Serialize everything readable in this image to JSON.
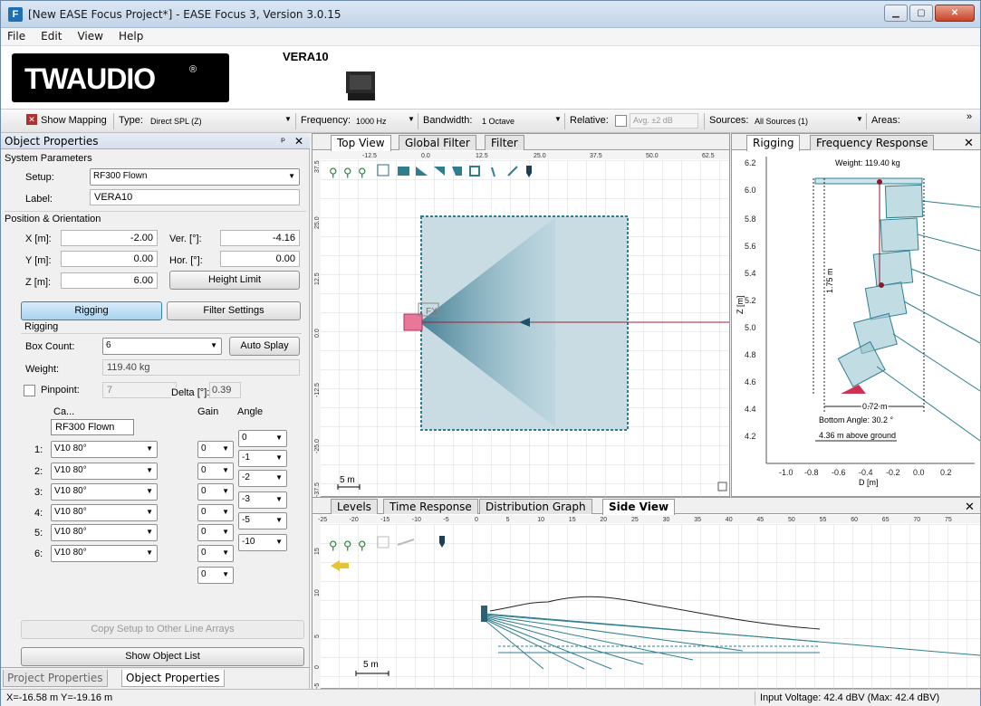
{
  "window": {
    "title": "[New EASE Focus Project*] - EASE Focus 3, Version 3.0.15"
  },
  "menu": [
    "File",
    "Edit",
    "View",
    "Help"
  ],
  "brand": {
    "logo_text": "TWAUDIO",
    "logo_mark": "®",
    "device_name": "VERA10"
  },
  "toolbar": {
    "show_mapping": "Show Mapping",
    "type_label": "Type:",
    "type_value": "Direct SPL (Z)",
    "frequency_label": "Frequency:",
    "frequency_value": "1000 Hz",
    "bandwidth_label": "Bandwidth:",
    "bandwidth_value": "1 Octave",
    "relative_label": "Relative:",
    "avg_value": "Avg. ±2 dB",
    "sources_label": "Sources:",
    "sources_value": "All Sources (1)",
    "areas_label": "Areas:",
    "overflow": "»"
  },
  "object_properties": {
    "header": "Object Properties",
    "pin": "ᵖ",
    "close": "✕",
    "system_parameters": "System Parameters",
    "setup_label": "Setup:",
    "setup_value": "RF300 Flown",
    "label_label": "Label:",
    "label_value": "VERA10",
    "position_orientation": "Position & Orientation",
    "x_label": "X [m]:",
    "x_value": "-2.00",
    "y_label": "Y [m]:",
    "y_value": "0.00",
    "z_label": "Z [m]:",
    "z_value": "6.00",
    "ver_label": "Ver. [°]:",
    "ver_value": "-4.16",
    "hor_label": "Hor. [°]:",
    "hor_value": "0.00",
    "height_limit": "Height Limit",
    "rigging_button": "Rigging",
    "filter_settings_button": "Filter Settings",
    "rigging_title": "Rigging",
    "box_count_label": "Box Count:",
    "box_count_value": "6",
    "auto_splay": "Auto Splay",
    "weight_label": "Weight:",
    "weight_value": "119.40 kg",
    "pinpoint_label": "Pinpoint:",
    "pinpoint_value": "7",
    "delta_label": "Delta [°]:",
    "delta_value": "0.39",
    "col_cabinet": "Ca...",
    "col_gain": "Gain",
    "col_angle": "Angle",
    "cabinet_header_value": "RF300 Flown",
    "boxes": [
      {
        "num": "1:",
        "cabinet": "V10 80°",
        "gain": "0"
      },
      {
        "num": "2:",
        "cabinet": "V10 80°",
        "gain": "0"
      },
      {
        "num": "3:",
        "cabinet": "V10 80°",
        "gain": "0"
      },
      {
        "num": "4:",
        "cabinet": "V10 80°",
        "gain": "0"
      },
      {
        "num": "5:",
        "cabinet": "V10 80°",
        "gain": "0"
      },
      {
        "num": "6:",
        "cabinet": "V10 80°",
        "gain": "0"
      }
    ],
    "extra_gain": "0",
    "angles": [
      "0",
      "-1",
      "-2",
      "-3",
      "-5",
      "-10"
    ],
    "copy_setup": "Copy Setup to Other Line Arrays",
    "show_object_list": "Show Object List",
    "tab_project": "Project Properties",
    "tab_object": "Object Properties"
  },
  "top_view": {
    "tabs": [
      "Top View",
      "Global Filter",
      "Filter"
    ],
    "x_ticks": [
      "-12.5",
      "0.0",
      "12.5",
      "25.0",
      "37.5",
      "50.0",
      "62.5"
    ],
    "y_ticks": [
      "37.5",
      "25.0",
      "12.5",
      "0.0",
      "-12.5",
      "-25.0",
      "-37.5"
    ],
    "scale_label": "5 m",
    "fx_label": "FX"
  },
  "rigging_pane": {
    "tabs": [
      "Rigging",
      "Frequency Response"
    ],
    "close": "✕",
    "weight_text": "Weight: 119.40 kg",
    "height_text": "1.75 m",
    "width_text": "0.72 m",
    "bottom_angle": "Bottom Angle: 30.2 °",
    "above_ground": "4.36 m above ground",
    "z_axis_label": "Z [m]",
    "d_axis_label": "D [m]",
    "z_ticks": [
      "6.2",
      "6.0",
      "5.8",
      "5.6",
      "5.4",
      "5.2",
      "5.0",
      "4.8",
      "4.6",
      "4.4",
      "4.2"
    ],
    "d_ticks": [
      "-1.0",
      "-0.8",
      "-0.6",
      "-0.4",
      "-0.2",
      "0.0",
      "0.2"
    ]
  },
  "side_view": {
    "tabs": [
      "Levels",
      "Time Response",
      "Distribution Graph",
      "Side View"
    ],
    "close": "✕",
    "x_ticks": [
      "-25",
      "-20",
      "-15",
      "-10",
      "-5",
      "0",
      "5",
      "10",
      "15",
      "20",
      "25",
      "30",
      "35",
      "40",
      "45",
      "50",
      "55",
      "60",
      "65",
      "70",
      "75"
    ],
    "y_ticks": [
      "15",
      "10",
      "5",
      "0",
      "-5"
    ],
    "scale_label": "5 m"
  },
  "status": {
    "coords": "X=-16.58 m Y=-19.16 m",
    "voltage": "Input Voltage: 42.4 dBV (Max: 42.4 dBV)"
  },
  "colors": {
    "teal": "#2d7f8f",
    "coverage": "#7fb3c4",
    "speaker_pink": "#e8779a",
    "arrow_red": "#a02030"
  }
}
